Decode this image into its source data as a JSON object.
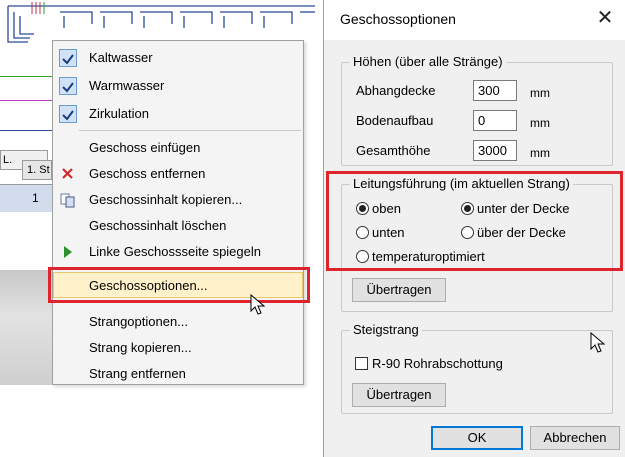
{
  "context_menu": {
    "items": [
      {
        "label": "Kaltwasser",
        "checked": true
      },
      {
        "label": "Warmwasser",
        "checked": true
      },
      {
        "label": "Zirkulation",
        "checked": true
      },
      {
        "label": "Geschoss einfügen"
      },
      {
        "label": "Geschoss entfernen",
        "icon": "delete-x-icon"
      },
      {
        "label": "Geschossinhalt kopieren...",
        "icon": "copy-icon"
      },
      {
        "label": "Geschossinhalt löschen"
      },
      {
        "label": "Linke Geschossseite spiegeln",
        "icon": "play-arrow-icon"
      },
      {
        "label": "Geschossoptionen...",
        "highlighted": true
      },
      {
        "label": "Strangoptionen..."
      },
      {
        "label": "Strang kopieren..."
      },
      {
        "label": "Strang entfernen"
      }
    ]
  },
  "background": {
    "tab1": "L.",
    "tab2": "1. St",
    "tab3": "1"
  },
  "dialog": {
    "title": "Geschossoptionen",
    "close_glyph": "✕",
    "heights_group": {
      "legend": "Höhen (über alle Stränge)",
      "rows": [
        {
          "label": "Abhangdecke",
          "value": "300",
          "unit": "mm"
        },
        {
          "label": "Bodenaufbau",
          "value": "0",
          "unit": "mm"
        },
        {
          "label": "Gesamthöhe",
          "value": "3000",
          "unit": "mm"
        }
      ]
    },
    "routing_group": {
      "legend": "Leitungsführung (im aktuellen Strang)",
      "radio_oben": "oben",
      "radio_unten": "unten",
      "radio_unter_decke": "unter der Decke",
      "radio_ueber_decke": "über der Decke",
      "radio_temp": "temperaturoptimiert",
      "selected_position": "oben",
      "selected_ceiling": "unter der Decke",
      "apply_button": "Übertragen"
    },
    "riser_group": {
      "legend": "Steigstrang",
      "checkbox_label": "R-90 Rohrabschottung",
      "checkbox_checked": false,
      "apply_button": "Übertragen"
    },
    "ok_button": "OK",
    "cancel_button": "Abbrechen"
  },
  "colors": {
    "highlight_red": "#e0242c",
    "menu_hover": "#fff1c9",
    "accent_blue": "#0078d7"
  }
}
